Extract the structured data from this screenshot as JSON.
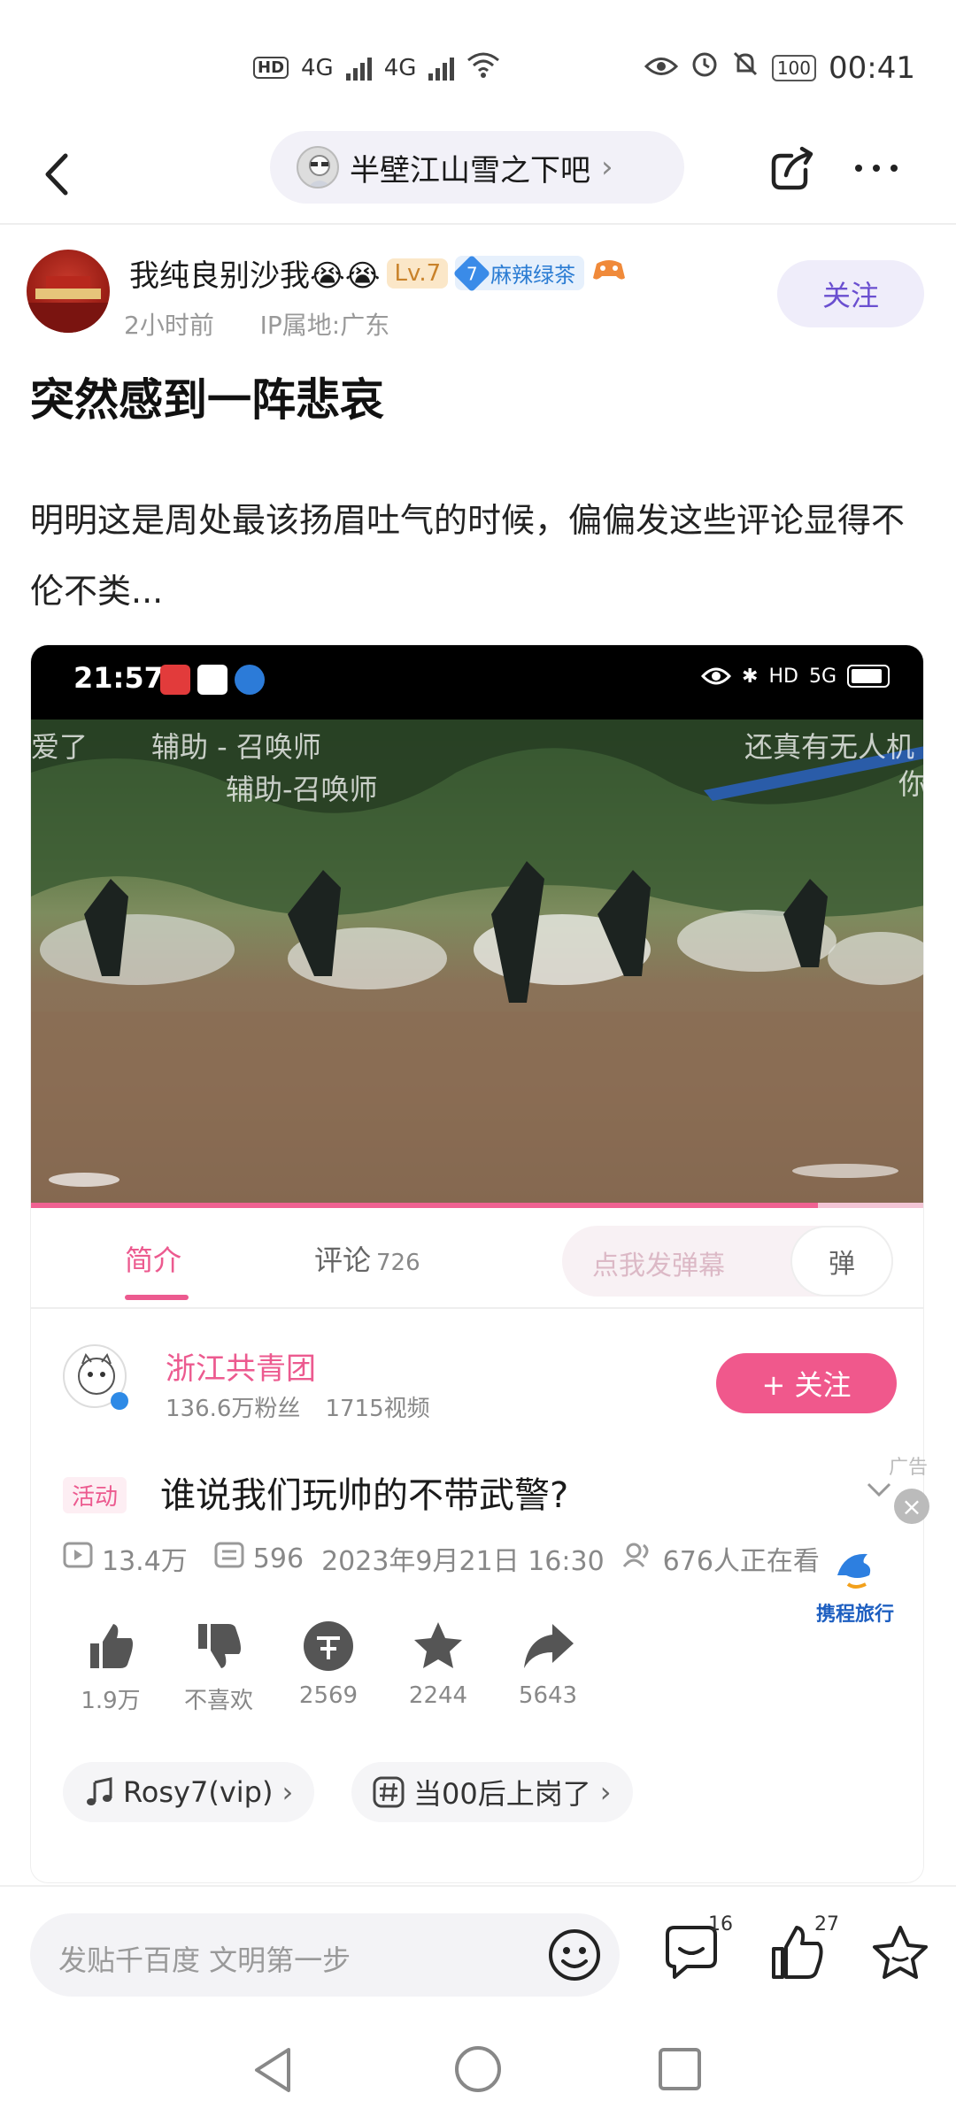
{
  "status_bar": {
    "network": "4G",
    "time": "00:41",
    "battery": "100"
  },
  "header": {
    "forum_name": "半壁江山雪之下吧"
  },
  "post": {
    "author": "我纯良别沙我😭😭",
    "level": "Lv.7",
    "badge_num": "7",
    "badge_name": "麻辣绿茶",
    "time": "2小时前",
    "ip": "IP属地:广东",
    "follow_label": "关注",
    "title": "突然感到一阵悲哀",
    "body": "明明这是周处最该扬眉吐气的时候，偏偏发这些评论显得不伦不类..."
  },
  "embedded": {
    "phone_time": "21:57",
    "danmaku": [
      "辅助 - 召唤师",
      "辅助-召唤师",
      "还真有无人机",
      "你"
    ],
    "tab_intro": "简介",
    "tab_comments": "评论",
    "comment_count": "726",
    "danmu_placeholder": "点我发弹幕",
    "danmu_btn": "弹",
    "uploader": "浙江共青团",
    "uploader_fans": "136.6万粉丝",
    "uploader_videos": "1715视频",
    "follow_label": "+ 关注",
    "activity_tag": "活动",
    "video_title": "谁说我们玩帅的不带武警?",
    "views": "13.4万",
    "danmaku_count": "596",
    "date": "2023年9月21日 16:30",
    "watching": "676人正在看",
    "like": "1.9万",
    "dislike": "不喜欢",
    "coin": "2569",
    "fav": "2244",
    "share": "5643",
    "music": "Rosy7(vip)",
    "topic": "当00后上岗了",
    "progress": 0.88
  },
  "ad": {
    "label": "广告",
    "brand": "携程旅行"
  },
  "bottom_bar": {
    "input_placeholder": "发贴千百度 文明第一步",
    "comment_count": "16",
    "like_count": "27"
  }
}
